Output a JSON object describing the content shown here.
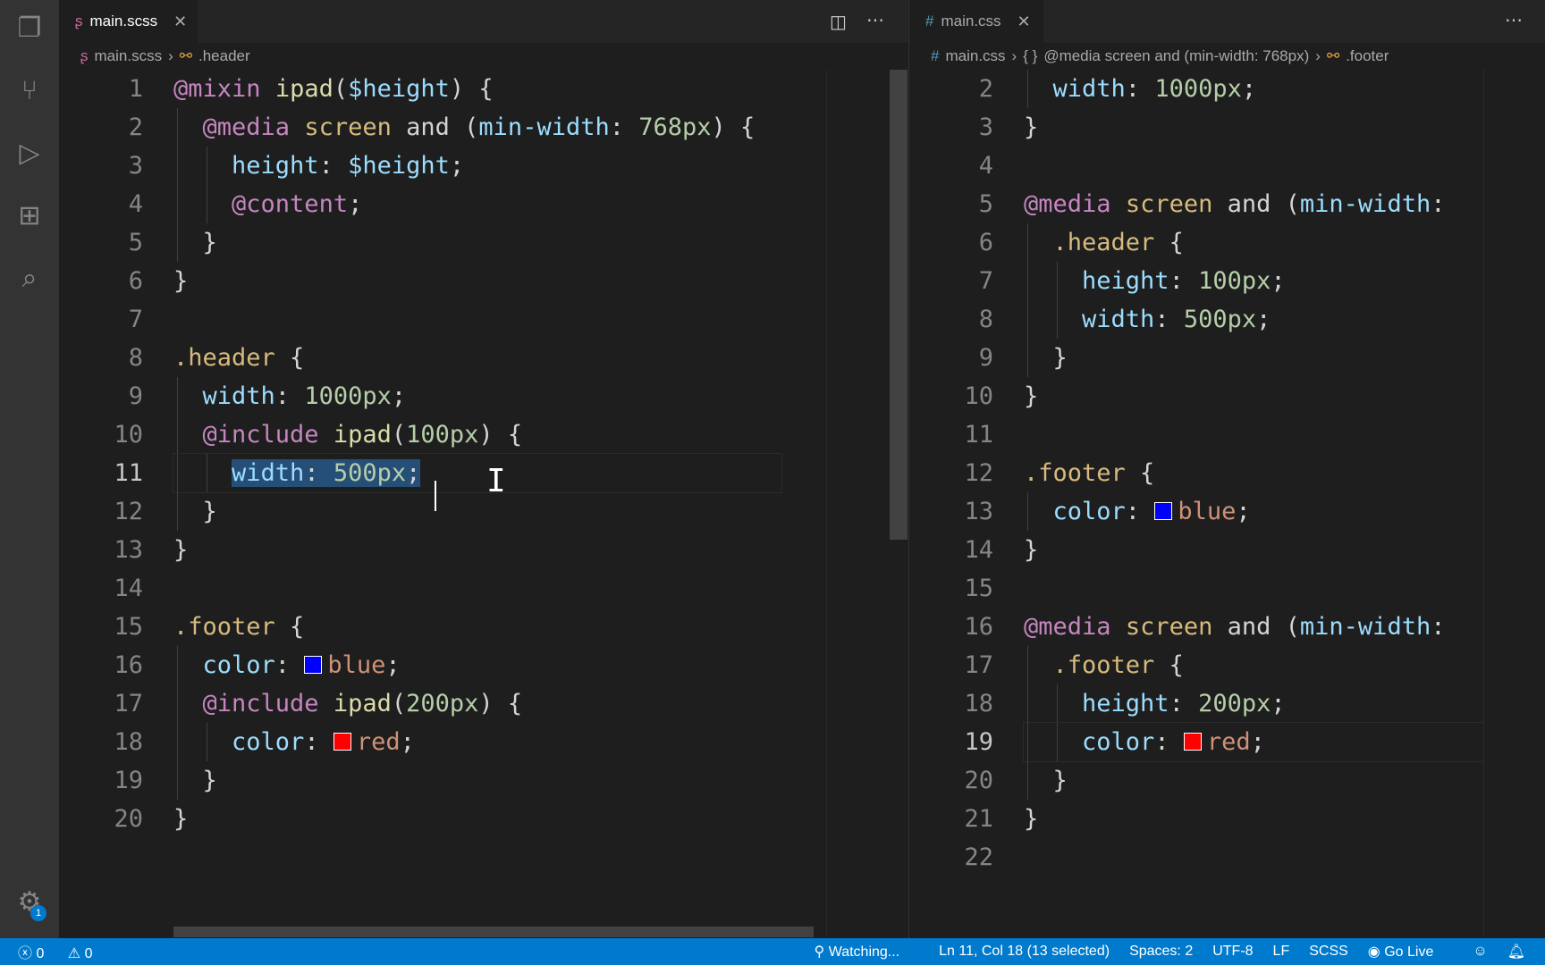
{
  "left": {
    "tab": "main.scss",
    "breadcrumb": [
      "main.scss",
      ".header"
    ],
    "cursor_line": 11,
    "lines": [
      [
        [
          "@mixin",
          "#c586c0"
        ],
        " ",
        [
          "ipad",
          "#dcdcaa"
        ],
        "(",
        [
          "$height",
          "#9cdcfe"
        ],
        ") {"
      ],
      [
        "  ",
        [
          "@media",
          "#c586c0"
        ],
        " ",
        [
          "screen",
          "#d7ba7d"
        ],
        " and (",
        [
          "min-width",
          "#9cdcfe"
        ],
        ": ",
        [
          "768px",
          "#b5cea8"
        ],
        ") {"
      ],
      [
        "    ",
        [
          "height",
          "#9cdcfe"
        ],
        ": ",
        [
          "$height",
          "#9cdcfe"
        ],
        ";"
      ],
      [
        "    ",
        [
          "@content",
          "#c586c0"
        ],
        ";"
      ],
      [
        "  }"
      ],
      [
        "}"
      ],
      [
        ""
      ],
      [
        [
          ".header",
          "#d7ba7d"
        ],
        " {"
      ],
      [
        "  ",
        [
          "width",
          "#9cdcfe"
        ],
        ": ",
        [
          "1000px",
          "#b5cea8"
        ],
        ";"
      ],
      [
        "  ",
        [
          "@include",
          "#c586c0"
        ],
        " ",
        [
          "ipad",
          "#dcdcaa"
        ],
        "(",
        [
          "100px",
          "#b5cea8"
        ],
        ") {"
      ],
      [
        "    ",
        [
          "width",
          "#9cdcfe",
          "sel"
        ],
        [
          ": ",
          "#d4d4d4",
          "sel"
        ],
        [
          "500px",
          "#b5cea8",
          "sel"
        ],
        [
          ";",
          "#d4d4d4",
          "sel"
        ]
      ],
      [
        "  }"
      ],
      [
        "}"
      ],
      [
        ""
      ],
      [
        [
          ".footer",
          "#d7ba7d"
        ],
        " {"
      ],
      [
        "  ",
        [
          "color",
          "#9cdcfe"
        ],
        ": ",
        [
          "#0000ff",
          "swatch"
        ],
        [
          "blue",
          "#ce9178"
        ],
        ";"
      ],
      [
        "  ",
        [
          "@include",
          "#c586c0"
        ],
        " ",
        [
          "ipad",
          "#dcdcaa"
        ],
        "(",
        [
          "200px",
          "#b5cea8"
        ],
        ") {"
      ],
      [
        "    ",
        [
          "color",
          "#9cdcfe"
        ],
        ": ",
        [
          "#ff0000",
          "swatch"
        ],
        [
          "red",
          "#ce9178"
        ],
        ";"
      ],
      [
        "  }"
      ],
      [
        "}"
      ]
    ]
  },
  "right": {
    "tab": "main.css",
    "breadcrumb": [
      "main.css",
      "@media screen and (min-width: 768px)",
      ".footer"
    ],
    "first_line": 2,
    "cursor_line": 19,
    "lines": [
      [
        "  ",
        [
          "width",
          "#9cdcfe"
        ],
        ": ",
        [
          "1000px",
          "#b5cea8"
        ],
        ";"
      ],
      [
        "}"
      ],
      [
        ""
      ],
      [
        [
          "@media",
          "#c586c0"
        ],
        " ",
        [
          "screen",
          "#d7ba7d"
        ],
        " and (",
        [
          "min-width",
          "#9cdcfe"
        ],
        ":"
      ],
      [
        "  ",
        [
          ".header",
          "#d7ba7d"
        ],
        " {"
      ],
      [
        "    ",
        [
          "height",
          "#9cdcfe"
        ],
        ": ",
        [
          "100px",
          "#b5cea8"
        ],
        ";"
      ],
      [
        "    ",
        [
          "width",
          "#9cdcfe"
        ],
        ": ",
        [
          "500px",
          "#b5cea8"
        ],
        ";"
      ],
      [
        "  }"
      ],
      [
        "}"
      ],
      [
        ""
      ],
      [
        [
          ".footer",
          "#d7ba7d"
        ],
        " {"
      ],
      [
        "  ",
        [
          "color",
          "#9cdcfe"
        ],
        ": ",
        [
          "#0000ff",
          "swatch"
        ],
        [
          "blue",
          "#ce9178"
        ],
        ";"
      ],
      [
        "}"
      ],
      [
        ""
      ],
      [
        [
          "@media",
          "#c586c0"
        ],
        " ",
        [
          "screen",
          "#d7ba7d"
        ],
        " and (",
        [
          "min-width",
          "#9cdcfe"
        ],
        ":"
      ],
      [
        "  ",
        [
          ".footer",
          "#d7ba7d"
        ],
        " {"
      ],
      [
        "    ",
        [
          "height",
          "#9cdcfe"
        ],
        ": ",
        [
          "200px",
          "#b5cea8"
        ],
        ";"
      ],
      [
        "    ",
        [
          "color",
          "#9cdcfe"
        ],
        ": ",
        [
          "#ff0000",
          "swatch"
        ],
        [
          "red",
          "#ce9178"
        ],
        ";"
      ],
      [
        "  }"
      ],
      [
        "}"
      ],
      [
        ""
      ]
    ]
  },
  "status": {
    "errors": "0",
    "warnings": "0",
    "watching": "Watching...",
    "position": "Ln 11, Col 18 (13 selected)",
    "spaces": "Spaces: 2",
    "encoding": "UTF-8",
    "eol": "LF",
    "language": "SCSS",
    "golive": "Go Live"
  },
  "settings_badge": "1"
}
